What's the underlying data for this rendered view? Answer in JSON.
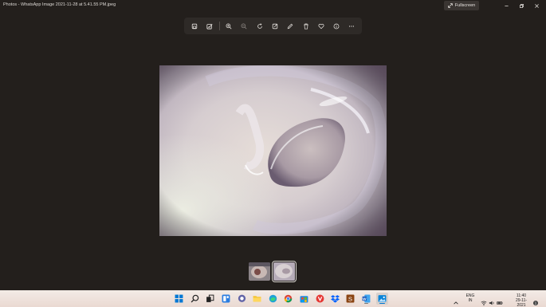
{
  "window": {
    "title": "Photos - WhatsApp Image 2021-11-28 at 5.41.55 PM.jpeg",
    "fullscreen_label": "Fullscreen"
  },
  "toolbar": {
    "tools": [
      "save-icon",
      "edit-image-icon",
      "zoom-in-icon",
      "zoom-out-icon",
      "rotate-icon",
      "crop-icon",
      "draw-icon",
      "delete-icon",
      "favorite-icon",
      "info-icon",
      "more-icon"
    ]
  },
  "filmstrip": {
    "count": 2,
    "selected_index": 1
  },
  "taskbar": {
    "apps": [
      "start",
      "search",
      "task-view",
      "widgets",
      "chat",
      "file-explorer",
      "edge",
      "chrome",
      "store",
      "app-red",
      "dropbox",
      "app-s",
      "word",
      "photos"
    ],
    "language_line1": "ENG",
    "language_line2": "IN",
    "time": "11:40",
    "date": "29-11-2021"
  },
  "colors": {
    "background": "#231f1c",
    "taskbar": "#f0e4de",
    "accent": "#0078d4"
  }
}
